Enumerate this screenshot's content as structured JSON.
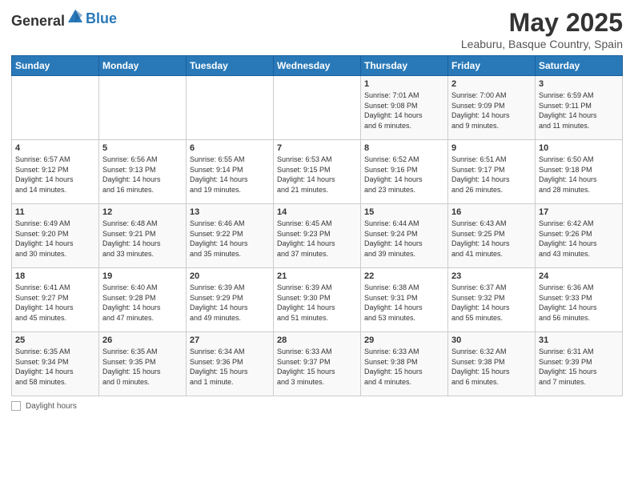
{
  "header": {
    "logo_general": "General",
    "logo_blue": "Blue",
    "title": "May 2025",
    "subtitle": "Leaburu, Basque Country, Spain"
  },
  "days_of_week": [
    "Sunday",
    "Monday",
    "Tuesday",
    "Wednesday",
    "Thursday",
    "Friday",
    "Saturday"
  ],
  "weeks": [
    {
      "days": [
        {
          "number": "",
          "info": ""
        },
        {
          "number": "",
          "info": ""
        },
        {
          "number": "",
          "info": ""
        },
        {
          "number": "",
          "info": ""
        },
        {
          "number": "1",
          "info": "Sunrise: 7:01 AM\nSunset: 9:08 PM\nDaylight: 14 hours\nand 6 minutes."
        },
        {
          "number": "2",
          "info": "Sunrise: 7:00 AM\nSunset: 9:09 PM\nDaylight: 14 hours\nand 9 minutes."
        },
        {
          "number": "3",
          "info": "Sunrise: 6:59 AM\nSunset: 9:11 PM\nDaylight: 14 hours\nand 11 minutes."
        }
      ]
    },
    {
      "days": [
        {
          "number": "4",
          "info": "Sunrise: 6:57 AM\nSunset: 9:12 PM\nDaylight: 14 hours\nand 14 minutes."
        },
        {
          "number": "5",
          "info": "Sunrise: 6:56 AM\nSunset: 9:13 PM\nDaylight: 14 hours\nand 16 minutes."
        },
        {
          "number": "6",
          "info": "Sunrise: 6:55 AM\nSunset: 9:14 PM\nDaylight: 14 hours\nand 19 minutes."
        },
        {
          "number": "7",
          "info": "Sunrise: 6:53 AM\nSunset: 9:15 PM\nDaylight: 14 hours\nand 21 minutes."
        },
        {
          "number": "8",
          "info": "Sunrise: 6:52 AM\nSunset: 9:16 PM\nDaylight: 14 hours\nand 23 minutes."
        },
        {
          "number": "9",
          "info": "Sunrise: 6:51 AM\nSunset: 9:17 PM\nDaylight: 14 hours\nand 26 minutes."
        },
        {
          "number": "10",
          "info": "Sunrise: 6:50 AM\nSunset: 9:18 PM\nDaylight: 14 hours\nand 28 minutes."
        }
      ]
    },
    {
      "days": [
        {
          "number": "11",
          "info": "Sunrise: 6:49 AM\nSunset: 9:20 PM\nDaylight: 14 hours\nand 30 minutes."
        },
        {
          "number": "12",
          "info": "Sunrise: 6:48 AM\nSunset: 9:21 PM\nDaylight: 14 hours\nand 33 minutes."
        },
        {
          "number": "13",
          "info": "Sunrise: 6:46 AM\nSunset: 9:22 PM\nDaylight: 14 hours\nand 35 minutes."
        },
        {
          "number": "14",
          "info": "Sunrise: 6:45 AM\nSunset: 9:23 PM\nDaylight: 14 hours\nand 37 minutes."
        },
        {
          "number": "15",
          "info": "Sunrise: 6:44 AM\nSunset: 9:24 PM\nDaylight: 14 hours\nand 39 minutes."
        },
        {
          "number": "16",
          "info": "Sunrise: 6:43 AM\nSunset: 9:25 PM\nDaylight: 14 hours\nand 41 minutes."
        },
        {
          "number": "17",
          "info": "Sunrise: 6:42 AM\nSunset: 9:26 PM\nDaylight: 14 hours\nand 43 minutes."
        }
      ]
    },
    {
      "days": [
        {
          "number": "18",
          "info": "Sunrise: 6:41 AM\nSunset: 9:27 PM\nDaylight: 14 hours\nand 45 minutes."
        },
        {
          "number": "19",
          "info": "Sunrise: 6:40 AM\nSunset: 9:28 PM\nDaylight: 14 hours\nand 47 minutes."
        },
        {
          "number": "20",
          "info": "Sunrise: 6:39 AM\nSunset: 9:29 PM\nDaylight: 14 hours\nand 49 minutes."
        },
        {
          "number": "21",
          "info": "Sunrise: 6:39 AM\nSunset: 9:30 PM\nDaylight: 14 hours\nand 51 minutes."
        },
        {
          "number": "22",
          "info": "Sunrise: 6:38 AM\nSunset: 9:31 PM\nDaylight: 14 hours\nand 53 minutes."
        },
        {
          "number": "23",
          "info": "Sunrise: 6:37 AM\nSunset: 9:32 PM\nDaylight: 14 hours\nand 55 minutes."
        },
        {
          "number": "24",
          "info": "Sunrise: 6:36 AM\nSunset: 9:33 PM\nDaylight: 14 hours\nand 56 minutes."
        }
      ]
    },
    {
      "days": [
        {
          "number": "25",
          "info": "Sunrise: 6:35 AM\nSunset: 9:34 PM\nDaylight: 14 hours\nand 58 minutes."
        },
        {
          "number": "26",
          "info": "Sunrise: 6:35 AM\nSunset: 9:35 PM\nDaylight: 15 hours\nand 0 minutes."
        },
        {
          "number": "27",
          "info": "Sunrise: 6:34 AM\nSunset: 9:36 PM\nDaylight: 15 hours\nand 1 minute."
        },
        {
          "number": "28",
          "info": "Sunrise: 6:33 AM\nSunset: 9:37 PM\nDaylight: 15 hours\nand 3 minutes."
        },
        {
          "number": "29",
          "info": "Sunrise: 6:33 AM\nSunset: 9:38 PM\nDaylight: 15 hours\nand 4 minutes."
        },
        {
          "number": "30",
          "info": "Sunrise: 6:32 AM\nSunset: 9:38 PM\nDaylight: 15 hours\nand 6 minutes."
        },
        {
          "number": "31",
          "info": "Sunrise: 6:31 AM\nSunset: 9:39 PM\nDaylight: 15 hours\nand 7 minutes."
        }
      ]
    }
  ],
  "footer": {
    "daylight_label": "Daylight hours"
  }
}
